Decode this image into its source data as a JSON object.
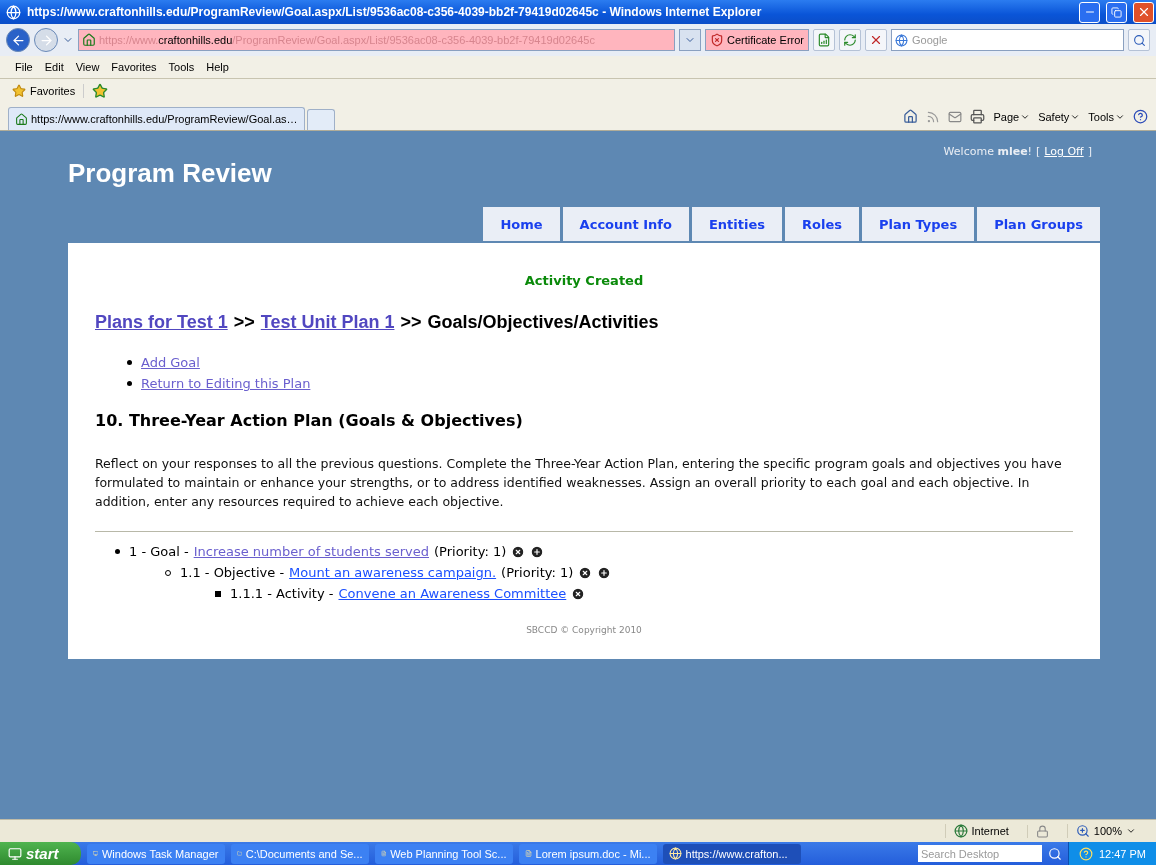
{
  "window": {
    "title": "https://www.craftonhills.edu/ProgramReview/Goal.aspx/List/9536ac08-c356-4039-bb2f-79419d02645c - Windows Internet Explorer"
  },
  "address_bar": {
    "scheme": "https://www.",
    "domain": "craftonhills.edu",
    "path": "/ProgramReview/Goal.aspx/List/9536ac08-c356-4039-bb2f-79419d02645c",
    "certificate": "Certificate Error"
  },
  "search": {
    "placeholder": "Google"
  },
  "menu": [
    "File",
    "Edit",
    "View",
    "Favorites",
    "Tools",
    "Help"
  ],
  "favorites_bar": {
    "label": "Favorites"
  },
  "tabs": [
    {
      "label": "https://www.craftonhills.edu/ProgramReview/Goal.as…",
      "selected": true
    }
  ],
  "command_bar": [
    "Page",
    "Safety",
    "Tools"
  ],
  "page": {
    "welcome": {
      "text": "Welcome **mlee**!",
      "open": "[",
      "link": "Log Off",
      "close": "]"
    },
    "site_title": "Program Review",
    "nav": [
      "Home",
      "Account Info",
      "Entities",
      "Roles",
      "Plan Types",
      "Plan Groups"
    ],
    "message": "Activity Created",
    "breadcrumb": [
      {
        "kind": "link",
        "label": "Plans for Test 1"
      },
      {
        "kind": "separator",
        "label": ">>"
      },
      {
        "kind": "link",
        "label": "Test Unit Plan 1"
      },
      {
        "kind": "separator",
        "label": ">>"
      },
      {
        "kind": "text",
        "label": "Goals/Objectives/Activities"
      }
    ],
    "actions": [
      "Add Goal",
      "Return to Editing this Plan"
    ],
    "section_title": "10. Three-Year Action Plan (Goals & Objectives)",
    "description": "Reflect on your responses to all the previous questions. Complete the Three-Year Action Plan, entering the specific program goals and objectives you have formulated to maintain or enhance your strengths, or to address identified weaknesses. Assign an overall priority to each goal and each objective. In addition, enter any resources required to achieve each objective.",
    "tree": [
      {
        "prefix": "1 - Goal -",
        "link": "Increase number of students served",
        "visited": true,
        "priority": "(Priority: 1)",
        "can_add": true,
        "children": [
          {
            "prefix": "1.1 - Objective -",
            "link": "Mount an awareness campaign.",
            "visited": false,
            "priority": "(Priority: 1)",
            "can_add": true,
            "children": [
              {
                "prefix": "1.1.1 - Activity -",
                "link": "Convene an Awareness Committee",
                "visited": false,
                "can_add": false
              }
            ]
          }
        ]
      }
    ],
    "footer": "SBCCD © Copyright 2010"
  },
  "status_bar": {
    "zone": "Internet",
    "zoom": "100%"
  },
  "taskbar": {
    "start": "start",
    "items": [
      {
        "label": "Windows Task Manager",
        "selected": false
      },
      {
        "label": "C:\\Documents and Se...",
        "selected": false
      },
      {
        "label": "Web Planning Tool Sc...",
        "selected": false
      },
      {
        "label": "Lorem ipsum.doc - Mi...",
        "selected": false
      },
      {
        "label": "https://www.crafton...",
        "selected": true
      }
    ],
    "search_placeholder": "Search Desktop",
    "clock": "12:47 PM"
  }
}
